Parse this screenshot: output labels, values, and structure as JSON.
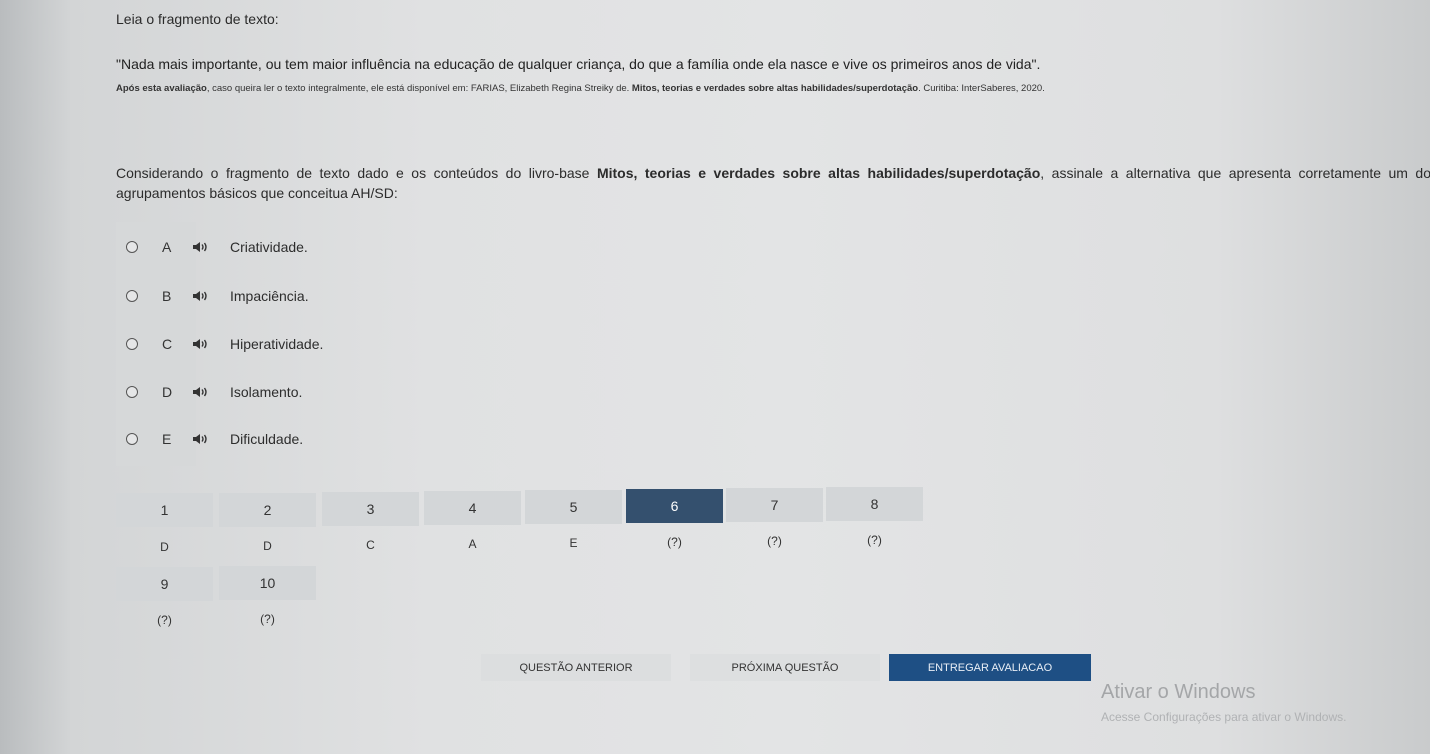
{
  "fragment_title": "Leia o fragmento de texto:",
  "quote": "\"Nada mais importante, ou tem maior influência na educação de qualquer criança, do que a família onde ela nasce e vive os primeiros anos de vida\".",
  "source": {
    "lead_bold": "Após esta avaliação",
    "text1": ", caso queira ler o texto integralmente, ele está disponível em: FARIAS, Elizabeth Regina Streiky de. ",
    "book_bold": "Mitos, teorias e verdades sobre altas habilidades/superdotação",
    "text2": ". Curitiba: InterSaberes, 2020."
  },
  "question": {
    "part1": "Considerando o fragmento de texto dado e os conteúdos do livro-base ",
    "book_bold": "Mitos, teorias e verdades sobre altas habilidades/superdotação",
    "part2": ", assinale a alternativa que apresenta corretamente um dos agrupamentos básicos que conceitua AH/SD:"
  },
  "options": [
    {
      "letter": "A",
      "text": "Criatividade.",
      "icon": "speaker-icon"
    },
    {
      "letter": "B",
      "text": "Impaciência.",
      "icon": "speaker-icon"
    },
    {
      "letter": "C",
      "text": "Hiperatividade.",
      "icon": "speaker-icon"
    },
    {
      "letter": "D",
      "text": "Isolamento.",
      "icon": "speaker-icon"
    },
    {
      "letter": "E",
      "text": "Dificuldade.",
      "icon": "speaker-icon"
    }
  ],
  "nav": [
    {
      "num": "1",
      "answer": "D"
    },
    {
      "num": "2",
      "answer": "D"
    },
    {
      "num": "3",
      "answer": "C"
    },
    {
      "num": "4",
      "answer": "A"
    },
    {
      "num": "5",
      "answer": "E"
    },
    {
      "num": "6",
      "answer": "(?)"
    },
    {
      "num": "7",
      "answer": "(?)"
    },
    {
      "num": "8",
      "answer": "(?)"
    },
    {
      "num": "9",
      "answer": "(?)"
    },
    {
      "num": "10",
      "answer": "(?)"
    }
  ],
  "active_question": "6",
  "buttons": {
    "prev": "QUESTÃO ANTERIOR",
    "next": "PRÓXIMA QUESTÃO",
    "submit": "ENTREGAR AVALIACAO"
  },
  "watermark": {
    "line1": "Ativar o Windows",
    "line2": "Acesse Configurações para ativar o Windows."
  },
  "colors": {
    "active_cell": "#34506e",
    "submit_button": "#1e4f84"
  }
}
